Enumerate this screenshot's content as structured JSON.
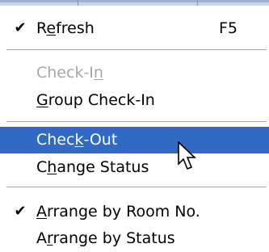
{
  "menu": {
    "items": [
      {
        "id": "refresh",
        "pre": "R",
        "mn": "e",
        "post": "fresh",
        "shortcut": "F5",
        "checked": true,
        "check_glyph": "✔"
      },
      {
        "id": "check-in",
        "pre": "Check-I",
        "mn": "n",
        "post": "",
        "disabled": true
      },
      {
        "id": "group-check-in",
        "pre": "",
        "mn": "G",
        "post": "roup Check-In"
      },
      {
        "id": "check-out",
        "pre": "Chec",
        "mn": "k",
        "post": "-Out",
        "selected": true
      },
      {
        "id": "change-status",
        "pre": "C",
        "mn": "h",
        "post": "ange Status"
      },
      {
        "id": "arrange-by-room",
        "pre": "",
        "mn": "A",
        "post": "rrange by Room No.",
        "checked": true,
        "check_glyph": "✔"
      },
      {
        "id": "arrange-by-status",
        "pre": "A",
        "mn": "r",
        "post": "range by Status"
      }
    ]
  },
  "colors": {
    "highlight": "#316ac5",
    "disabled_text": "#a7a7a7"
  },
  "cursor_icon": "arrow-cursor"
}
